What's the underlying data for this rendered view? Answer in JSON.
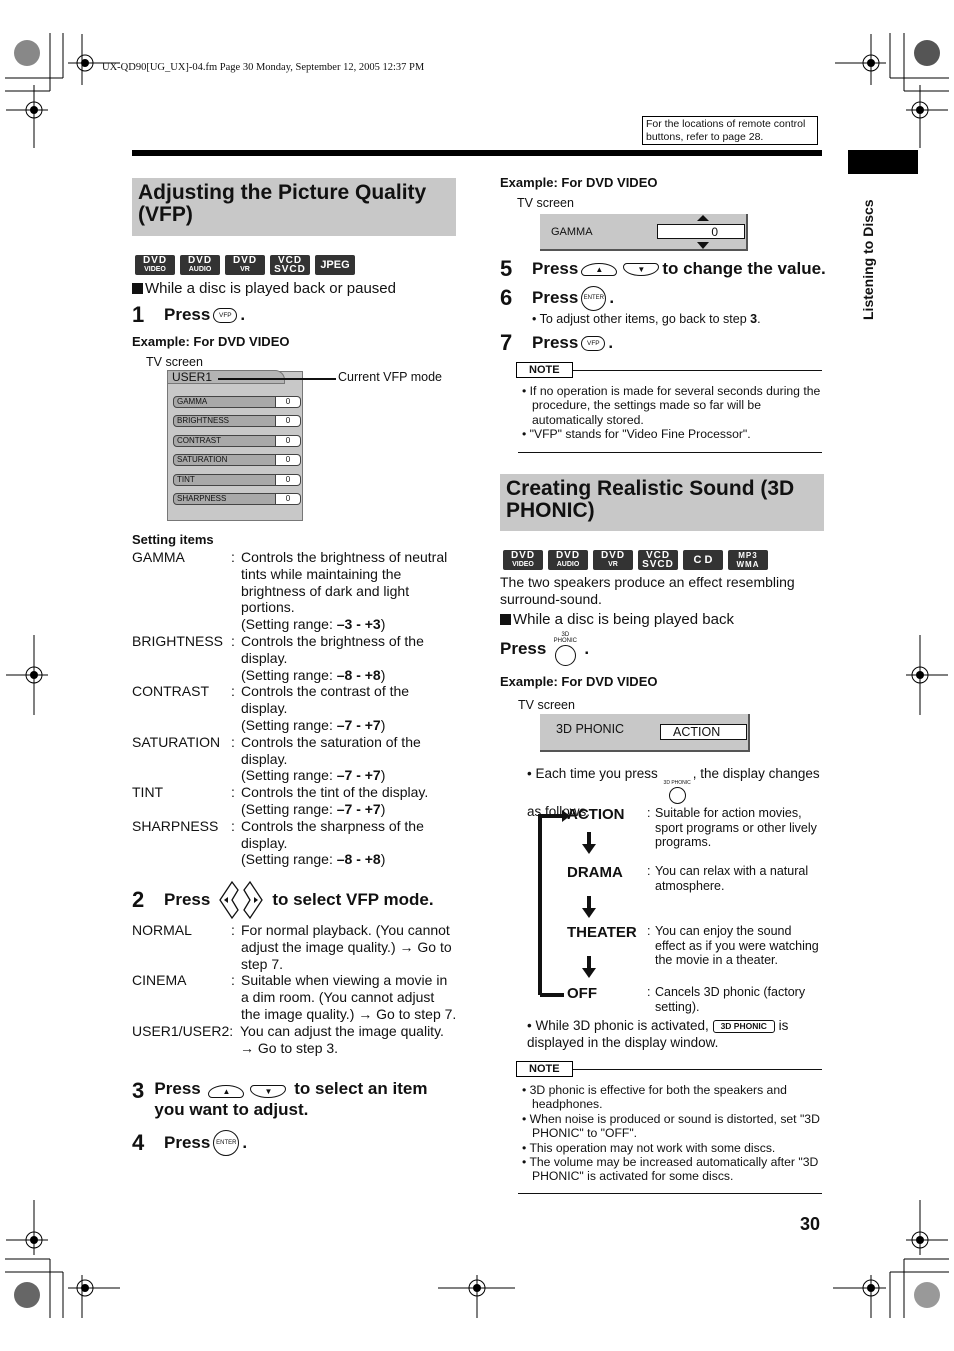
{
  "header": {
    "file_info": "UX-QD90[UG_UX]-04.fm  Page 30  Monday, September 12, 2005  12:37 PM",
    "reference_note": "For the locations of remote control buttons, refer to page 28.",
    "side_tab": "Listening to Discs",
    "page_number": "30"
  },
  "vfp": {
    "title": "Adjusting the Picture Quality (VFP)",
    "badges": [
      {
        "top": "DVD",
        "bottom": "VIDEO"
      },
      {
        "top": "DVD",
        "bottom": "AUDIO"
      },
      {
        "top": "DVD",
        "bottom": "VR"
      },
      {
        "top": "VCD",
        "bottom": "SVCD"
      },
      {
        "top": "JPEG",
        "bottom": ""
      }
    ],
    "condition": "While a disc is played back or paused",
    "step1": {
      "num": "1",
      "text": "Press",
      "button": "VFP"
    },
    "example1_title": "Example: For DVD VIDEO",
    "tv_screen_label": "TV screen",
    "tv_mode": "USER1",
    "tv_mode_callout": "Current VFP mode",
    "tv_rows": [
      {
        "label": "GAMMA",
        "value": "0"
      },
      {
        "label": "BRIGHTNESS",
        "value": "0"
      },
      {
        "label": "CONTRAST",
        "value": "0"
      },
      {
        "label": "SATURATION",
        "value": "0"
      },
      {
        "label": "TINT",
        "value": "0"
      },
      {
        "label": "SHARPNESS",
        "value": "0"
      }
    ],
    "setting_items_title": "Setting items",
    "setting_items": [
      {
        "name": "GAMMA",
        "desc": "Controls the brightness of neutral tints while maintaining the brightness of dark and light portions.",
        "range_prefix": "(Setting range: ",
        "range": "–3 - +3",
        "range_suffix": ")"
      },
      {
        "name": "BRIGHTNESS",
        "desc": "Controls the brightness of the display.",
        "range_prefix": "(Setting range: ",
        "range": "–8 - +8",
        "range_suffix": ")"
      },
      {
        "name": "CONTRAST",
        "desc": "Controls the contrast of the display.",
        "range_prefix": "(Setting range: ",
        "range": "–7 - +7",
        "range_suffix": ")"
      },
      {
        "name": "SATURATION",
        "desc": "Controls the saturation of the display.",
        "range_prefix": "(Setting range: ",
        "range": "–7 - +7",
        "range_suffix": ")"
      },
      {
        "name": "TINT",
        "desc": "Controls the tint of the display.",
        "range_prefix": "(Setting range: ",
        "range": "–7 - +7",
        "range_suffix": ")"
      },
      {
        "name": "SHARPNESS",
        "desc": "Controls the sharpness of the display.",
        "range_prefix": "(Setting range: ",
        "range": "–8 - +8",
        "range_suffix": ")"
      }
    ],
    "step2": {
      "num": "2",
      "text": "Press",
      "suffix": "to select VFP mode."
    },
    "modes": [
      {
        "name": "NORMAL",
        "desc": "For normal playback. (You cannot adjust the image quality.) → Go to step 7."
      },
      {
        "name": "CINEMA",
        "desc": "Suitable when viewing a movie in a dim room. (You cannot adjust the image quality.) → Go to step 7."
      },
      {
        "name": "USER1/USER2",
        "desc": "You can adjust the image quality. → Go to step 3."
      }
    ],
    "step3": {
      "num": "3",
      "text": "Press",
      "suffix": "to select an item you want to adjust."
    },
    "step4": {
      "num": "4",
      "text": "Press",
      "button": "ENTER"
    },
    "example2_title": "Example: For DVD VIDEO",
    "tv2_label": "GAMMA",
    "tv2_value": "0",
    "step5": {
      "num": "5",
      "text": "Press",
      "suffix": "to change the value."
    },
    "step6": {
      "num": "6",
      "text": "Press",
      "button": "ENTER",
      "sub_prefix": "• To adjust other items, go back to step ",
      "sub_step": "3",
      "sub_suffix": "."
    },
    "step7": {
      "num": "7",
      "text": "Press",
      "button": "VFP"
    },
    "note_label": "NOTE",
    "notes": [
      "If no operation is made for several seconds during the procedure, the settings made so far will be automatically stored.",
      "\"VFP\" stands for \"Video Fine Processor\"."
    ]
  },
  "phonic": {
    "title": "Creating Realistic Sound (3D PHONIC)",
    "badges": [
      {
        "top": "DVD",
        "bottom": "VIDEO"
      },
      {
        "top": "DVD",
        "bottom": "AUDIO"
      },
      {
        "top": "DVD",
        "bottom": "VR"
      },
      {
        "top": "VCD",
        "bottom": "SVCD"
      },
      {
        "top": "C D",
        "bottom": ""
      },
      {
        "top": "MP3",
        "bottom": "WMA"
      }
    ],
    "intro": "The two speakers produce an effect resembling surround-sound.",
    "condition": "While a disc is being played back",
    "press_text": "Press",
    "button_label": "3D PHONIC",
    "example_title": "Example: For DVD VIDEO",
    "tv_screen_label": "TV screen",
    "tv_label": "3D PHONIC",
    "tv_value": "ACTION",
    "each_time_prefix": "• Each time you press",
    "each_time_suffix": ", the display changes as follows.",
    "modes": [
      {
        "name": "ACTION",
        "desc": "Suitable for action movies, sport programs or other lively programs."
      },
      {
        "name": "DRAMA",
        "desc": "You can relax with a natural atmosphere."
      },
      {
        "name": "THEATER",
        "desc": "You can enjoy the sound effect as if you were watching the movie in a theater."
      },
      {
        "name": "OFF",
        "desc": "Cancels 3D phonic (factory setting)."
      }
    ],
    "activated_prefix": "• While 3D phonic is activated,",
    "indicator": "3D PHONIC",
    "activated_suffix": "is displayed in the display window.",
    "note_label": "NOTE",
    "notes": [
      "3D phonic is effective for both the speakers and headphones.",
      "When noise is produced or sound is distorted, set \"3D PHONIC\" to \"OFF\".",
      "This operation may not work with some discs.",
      "The volume may be increased automatically after \"3D PHONIC\" is activated for some discs."
    ]
  }
}
